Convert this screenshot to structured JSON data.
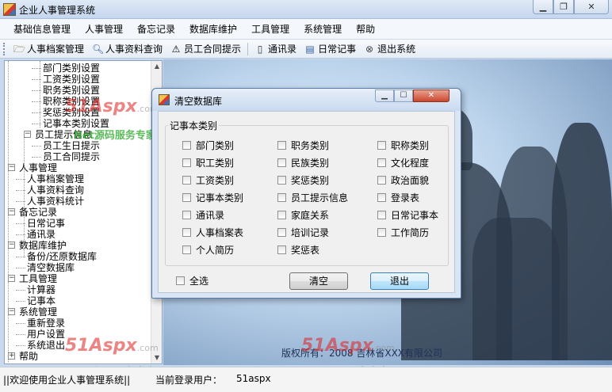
{
  "window": {
    "title": "企业人事管理系统"
  },
  "menubar": {
    "items": [
      "基础信息管理",
      "人事管理",
      "备忘记录",
      "数据库维护",
      "工具管理",
      "系统管理",
      "帮助"
    ]
  },
  "toolbar": {
    "items": [
      {
        "label": "人事档案管理",
        "icon": "folder-open-icon"
      },
      {
        "label": "人事资料查询",
        "icon": "magnifier-icon"
      },
      {
        "label": "员工合同提示",
        "icon": "warning-icon"
      },
      {
        "label": "通讯录",
        "icon": "phone-icon"
      },
      {
        "label": "日常记事",
        "icon": "notebook-icon"
      },
      {
        "label": "退出系统",
        "icon": "exit-icon"
      }
    ]
  },
  "tree": {
    "rows": [
      {
        "label": "部门类别设置",
        "indent": 3
      },
      {
        "label": "工资类别设置",
        "indent": 3
      },
      {
        "label": "职务类别设置",
        "indent": 3
      },
      {
        "label": "职称类别设置",
        "indent": 3
      },
      {
        "label": "奖惩类别设置",
        "indent": 3
      },
      {
        "label": "记事本类别设置",
        "indent": 3
      },
      {
        "label": "员工提示信息",
        "indent": 2,
        "expander": "−"
      },
      {
        "label": "员工生日提示",
        "indent": 3
      },
      {
        "label": "员工合同提示",
        "indent": 3
      },
      {
        "label": "人事管理",
        "indent": 1,
        "expander": "−"
      },
      {
        "label": "人事档案管理",
        "indent": 2
      },
      {
        "label": "人事资料查询",
        "indent": 2
      },
      {
        "label": "人事资料统计",
        "indent": 2
      },
      {
        "label": "备忘记录",
        "indent": 1,
        "expander": "−"
      },
      {
        "label": "日常记事",
        "indent": 2
      },
      {
        "label": "通讯录",
        "indent": 2
      },
      {
        "label": "数据库维护",
        "indent": 1,
        "expander": "−"
      },
      {
        "label": "备份/还原数据库",
        "indent": 2
      },
      {
        "label": "清空数据库",
        "indent": 2
      },
      {
        "label": "工具管理",
        "indent": 1,
        "expander": "−"
      },
      {
        "label": "计算器",
        "indent": 2
      },
      {
        "label": "记事本",
        "indent": 2
      },
      {
        "label": "系统管理",
        "indent": 1,
        "expander": "−"
      },
      {
        "label": "重新登录",
        "indent": 2
      },
      {
        "label": "用户设置",
        "indent": 2
      },
      {
        "label": "系统退出",
        "indent": 2
      },
      {
        "label": "帮助",
        "indent": 1,
        "expander": "+"
      }
    ]
  },
  "dialog": {
    "title": "清空数据库",
    "group_label": "记事本类别",
    "checkboxes": [
      [
        "部门类别",
        "职务类别",
        "职称类别"
      ],
      [
        "职工类别",
        "民族类别",
        "文化程度"
      ],
      [
        "工资类别",
        "奖惩类别",
        "政治面貌"
      ],
      [
        "记事本类别",
        "员工提示信息",
        "登录表"
      ],
      [
        "通讯录",
        "家庭关系",
        "日常记事本"
      ],
      [
        "人事档案表",
        "培训记录",
        "工作简历"
      ],
      [
        "个人简历",
        "奖惩表",
        ""
      ]
    ],
    "select_all_label": "全选",
    "clear_label": "清空",
    "exit_label": "退出"
  },
  "copyright": "版权所有：2008 吉林省XXX有限公司",
  "statusbar": {
    "welcome": "||欢迎使用企业人事管理系统||",
    "user_label": "当前登录用户：",
    "user_name": "51aspx"
  },
  "watermark": {
    "brand": "51Aspx",
    "domain": ".com",
    "slogan": ".Net源码服务专家"
  },
  "colors": {
    "dialog_bg": "#d9e5f4",
    "accent_button": "#a7d9f5",
    "watermark_red": "#e02020",
    "watermark_green": "#18a018"
  }
}
